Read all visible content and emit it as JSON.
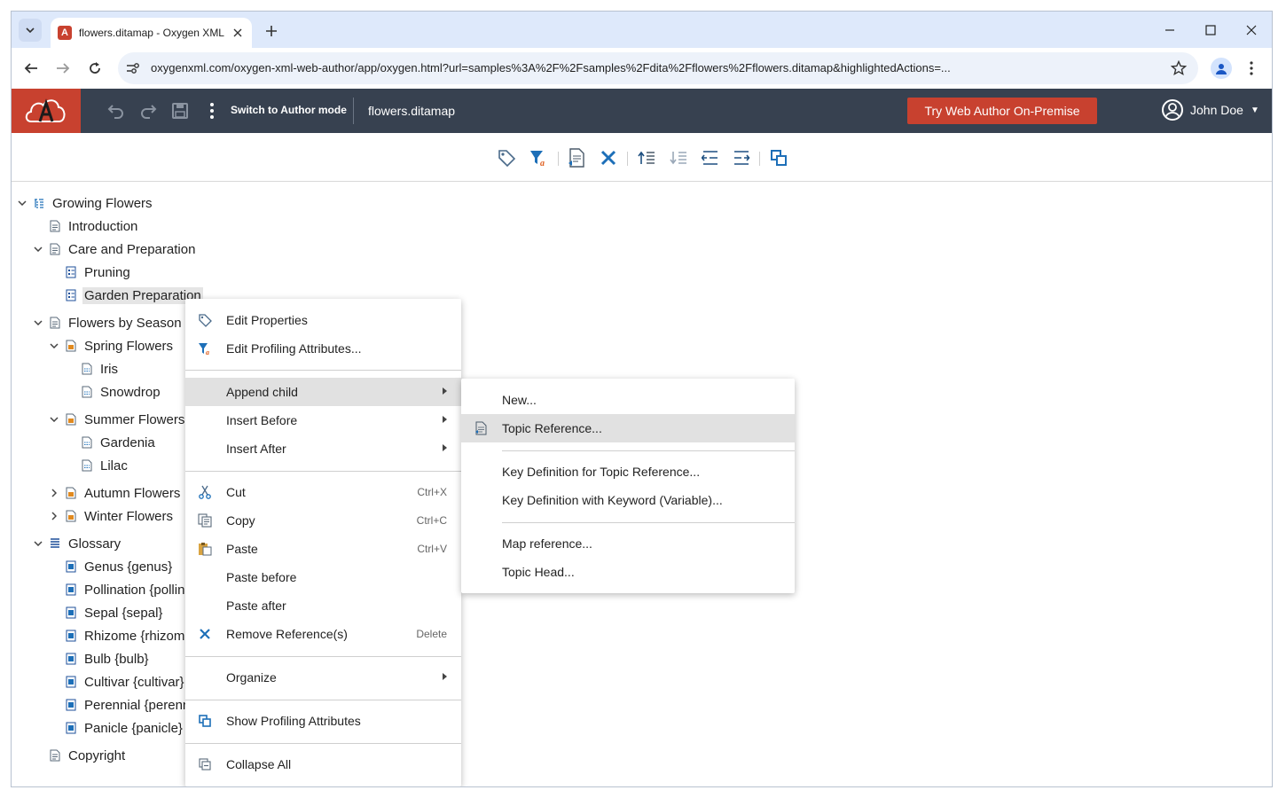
{
  "browser": {
    "tab_title": "flowers.ditamap - Oxygen XML",
    "url": "oxygenxml.com/oxygen-xml-web-author/app/oxygen.html?url=samples%3A%2F%2Fsamples%2Fdita%2Fflowers%2Fflowers.ditamap&highlightedActions=..."
  },
  "app": {
    "switch_mode_label": "Switch to Author mode",
    "document_name": "flowers.ditamap",
    "try_button_label": "Try Web Author On-Premise",
    "user_name": "John Doe",
    "accent_color": "#c8412f",
    "header_color": "#374150"
  },
  "toolbar": {
    "icons": [
      "edit-properties-icon",
      "edit-profiling-icon",
      "insert-topicref-icon",
      "remove-icon",
      "move-up-icon",
      "move-down-icon",
      "promote-icon",
      "demote-icon",
      "show-profiling-icon"
    ]
  },
  "tree": [
    {
      "label": "Growing Flowers",
      "icon": "map",
      "expanded": true
    },
    {
      "label": "Introduction",
      "icon": "topic"
    },
    {
      "label": "Care and Preparation",
      "icon": "topic",
      "expanded": true
    },
    {
      "label": "Pruning",
      "icon": "task"
    },
    {
      "label": "Garden Preparation",
      "icon": "task",
      "selected": true
    },
    {
      "label": "Flowers by Season",
      "icon": "topic",
      "expanded": true
    },
    {
      "label": "Spring Flowers",
      "icon": "orange",
      "expanded": true
    },
    {
      "label": "Iris",
      "icon": "ref"
    },
    {
      "label": "Snowdrop",
      "icon": "ref"
    },
    {
      "label": "Summer Flowers",
      "icon": "orange",
      "expanded": true
    },
    {
      "label": "Gardenia",
      "icon": "ref"
    },
    {
      "label": "Lilac",
      "icon": "ref"
    },
    {
      "label": "Autumn Flowers",
      "icon": "orange",
      "expanded": false
    },
    {
      "label": "Winter Flowers",
      "icon": "orange",
      "expanded": false
    },
    {
      "label": "Glossary",
      "icon": "glossary",
      "expanded": true
    },
    {
      "label": "Genus {genus}",
      "icon": "gloss"
    },
    {
      "label": "Pollination {pollination}",
      "icon": "gloss"
    },
    {
      "label": "Sepal {sepal}",
      "icon": "gloss"
    },
    {
      "label": "Rhizome {rhizome}",
      "icon": "gloss"
    },
    {
      "label": "Bulb {bulb}",
      "icon": "gloss"
    },
    {
      "label": "Cultivar {cultivar}",
      "icon": "gloss"
    },
    {
      "label": "Perennial {perennial}",
      "icon": "gloss"
    },
    {
      "label": "Panicle {panicle}",
      "icon": "gloss"
    },
    {
      "label": "Copyright",
      "icon": "topic"
    }
  ],
  "context_menu": {
    "items": [
      {
        "label": "Edit Properties",
        "icon": "tag-icon"
      },
      {
        "label": "Edit Profiling Attributes...",
        "icon": "filter-icon"
      },
      {
        "label": "Append child",
        "submenu": true
      },
      {
        "label": "Insert Before",
        "submenu": true
      },
      {
        "label": "Insert After",
        "submenu": true
      },
      {
        "label": "Cut",
        "shortcut": "Ctrl+X",
        "icon": "scissors-icon"
      },
      {
        "label": "Copy",
        "shortcut": "Ctrl+C",
        "icon": "copy-icon"
      },
      {
        "label": "Paste",
        "shortcut": "Ctrl+V",
        "icon": "paste-icon"
      },
      {
        "label": "Paste before"
      },
      {
        "label": "Paste after"
      },
      {
        "label": "Remove Reference(s)",
        "shortcut": "Delete",
        "icon": "remove-icon"
      },
      {
        "label": "Organize",
        "submenu": true
      },
      {
        "label": "Show Profiling Attributes",
        "icon": "profiling-icon"
      },
      {
        "label": "Collapse All",
        "icon": "collapse-icon"
      }
    ]
  },
  "submenu": {
    "items": [
      {
        "label": "New..."
      },
      {
        "label": "Topic Reference...",
        "icon": "topicref-icon"
      },
      {
        "label": "Key Definition for Topic Reference..."
      },
      {
        "label": "Key Definition with Keyword (Variable)..."
      },
      {
        "label": "Map reference..."
      },
      {
        "label": "Topic Head..."
      }
    ]
  }
}
